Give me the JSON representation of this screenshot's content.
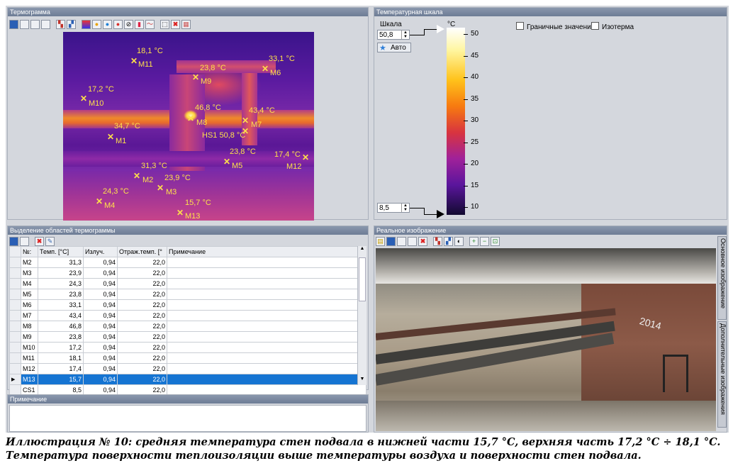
{
  "thermogram": {
    "title": "Термограмма",
    "markers": [
      {
        "id": "M11",
        "temp": "18,1 °C"
      },
      {
        "id": "M9",
        "temp": "23,8 °C"
      },
      {
        "id": "M6",
        "temp": "33,1 °C"
      },
      {
        "id": "M10",
        "temp": "17,2 °C"
      },
      {
        "id": "M8",
        "temp": "46,8 °C"
      },
      {
        "id": "M7",
        "temp": "43,4 °C"
      },
      {
        "id": "M1",
        "temp": "34,7 °C"
      },
      {
        "id": "HS1",
        "temp": "HS1 50,8 °C"
      },
      {
        "id": "M5",
        "temp": "23,8 °C"
      },
      {
        "id": "M12",
        "temp": "17,4 °C"
      },
      {
        "id": "M2",
        "temp": "31,3 °C"
      },
      {
        "id": "M3",
        "temp": "23,9 °C"
      },
      {
        "id": "M4",
        "temp": "24,3 °C"
      },
      {
        "id": "M13",
        "temp": "15,7 °C"
      }
    ]
  },
  "scale": {
    "title": "Температурная шкала",
    "label": "Шкала",
    "unit": "°C",
    "max_value": "50,8",
    "min_value": "8,5",
    "auto_button": "Авто",
    "boundary_label": "Граничные значения",
    "isotherm_label": "Изотерма",
    "ticks": [
      "50",
      "45",
      "40",
      "35",
      "30",
      "25",
      "20",
      "15",
      "10"
    ]
  },
  "regions": {
    "title": "Выделение областей термограммы",
    "columns": [
      "№:",
      "Темп. [°C]",
      "Излуч.",
      "Отраж.темп. [°",
      "Примечание"
    ],
    "rows": [
      {
        "id": "M2",
        "temp": "31,3",
        "emis": "0,94",
        "refl": "22,0",
        "note": ""
      },
      {
        "id": "M3",
        "temp": "23,9",
        "emis": "0,94",
        "refl": "22,0",
        "note": ""
      },
      {
        "id": "M4",
        "temp": "24,3",
        "emis": "0,94",
        "refl": "22,0",
        "note": ""
      },
      {
        "id": "M5",
        "temp": "23,8",
        "emis": "0,94",
        "refl": "22,0",
        "note": ""
      },
      {
        "id": "M6",
        "temp": "33,1",
        "emis": "0,94",
        "refl": "22,0",
        "note": ""
      },
      {
        "id": "M7",
        "temp": "43,4",
        "emis": "0,94",
        "refl": "22,0",
        "note": ""
      },
      {
        "id": "M8",
        "temp": "46,8",
        "emis": "0,94",
        "refl": "22,0",
        "note": ""
      },
      {
        "id": "M9",
        "temp": "23,8",
        "emis": "0,94",
        "refl": "22,0",
        "note": ""
      },
      {
        "id": "M10",
        "temp": "17,2",
        "emis": "0,94",
        "refl": "22,0",
        "note": ""
      },
      {
        "id": "M11",
        "temp": "18,1",
        "emis": "0,94",
        "refl": "22,0",
        "note": ""
      },
      {
        "id": "M12",
        "temp": "17,4",
        "emis": "0,94",
        "refl": "22,0",
        "note": ""
      },
      {
        "id": "M13",
        "temp": "15,7",
        "emis": "0,94",
        "refl": "22,0",
        "note": ""
      },
      {
        "id": "CS1",
        "temp": "8,5",
        "emis": "0,94",
        "refl": "22,0",
        "note": ""
      }
    ],
    "selected_row": "M13"
  },
  "note_panel": {
    "title": "Примечание"
  },
  "real_image": {
    "title": "Реальное изображение",
    "side_tab_1": "Основное изображение",
    "side_tab_2": "Дополнительные изображения",
    "wall_text": "2014"
  },
  "caption": {
    "line1": "Иллюстрация № 10: средняя температура стен подвала в нижней части 15,7 °C, верхняя часть 17,2 °C ÷ 18,1 °C.",
    "line2": "Температура поверхности теплоизоляции выше температуры воздуха и поверхности стен подвала."
  },
  "colors": {
    "title_bar": "#6d7c95",
    "panel_bg": "#d4d7dd",
    "selection": "#1574d2",
    "marker": "#ffe14a"
  }
}
